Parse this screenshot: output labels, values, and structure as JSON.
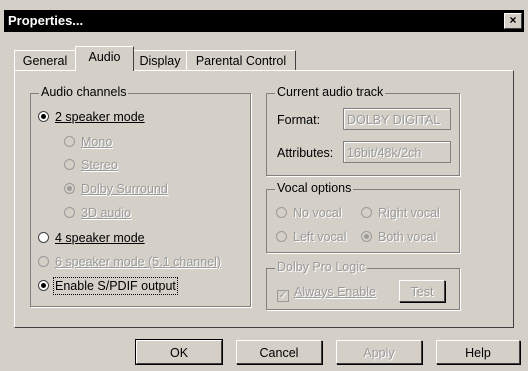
{
  "window": {
    "title": "Properties...",
    "close_glyph": "×"
  },
  "tabs": [
    {
      "label": "General"
    },
    {
      "label": "Audio"
    },
    {
      "label": "Display"
    },
    {
      "label": "Parental Control"
    }
  ],
  "audio_channels": {
    "title": "Audio channels",
    "two_speaker": "2 speaker mode",
    "sub_modes": [
      "Mono",
      "Stereo",
      "Dolby Surround",
      "3D audio"
    ],
    "four_speaker": "4 speaker mode",
    "six_speaker": "6 speaker mode (5.1 channel)",
    "spdif": "Enable S/PDIF output"
  },
  "current_track": {
    "title": "Current audio track",
    "format_label": "Format:",
    "format_value": "DOLBY DIGITAL",
    "attributes_label": "Attributes:",
    "attributes_value": "16bit/48k/2ch"
  },
  "vocal_options": {
    "title": "Vocal options",
    "no_vocal": "No vocal",
    "right_vocal": "Right vocal",
    "left_vocal": "Left vocal",
    "both_vocal": "Both vocal"
  },
  "pro_logic": {
    "title": "Dolby Pro Logic",
    "always_enable": "Always Enable",
    "test": "Test"
  },
  "buttons": {
    "ok": "OK",
    "cancel": "Cancel",
    "apply": "Apply",
    "help": "Help"
  }
}
